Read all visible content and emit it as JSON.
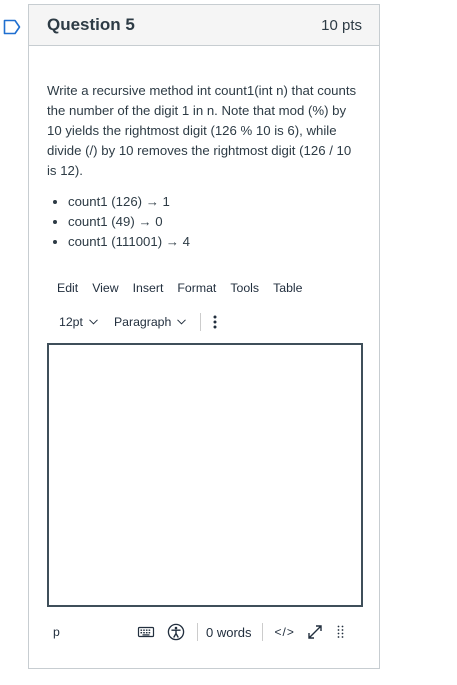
{
  "question": {
    "title": "Question 5",
    "points": "10 pts",
    "text": "Write a recursive method int count1(int n) that counts the number of the digit 1 in n. Note that mod (%) by 10 yields the rightmost digit (126 % 10 is 6), while divide (/) by 10 removes the rightmost digit (126 / 10 is 12).",
    "examples": [
      "count1 (126) → 1",
      "count1 (49) → 0",
      "count1 (111001) → 4"
    ]
  },
  "editor": {
    "menu": [
      "Edit",
      "View",
      "Insert",
      "Format",
      "Tools",
      "Table"
    ],
    "font_size": "12pt",
    "block_format": "Paragraph",
    "content": "",
    "status_path": "p",
    "word_count": "0 words",
    "code_toggle": "</>"
  },
  "colors": {
    "flag": "#1f6fd0",
    "header_bg": "#f5f5f5",
    "border": "#c7cdd1",
    "text": "#2d3b45",
    "editor_border": "#3f4f5a"
  },
  "icons": [
    "flag-icon",
    "chevron-down-icon",
    "more-vertical-icon",
    "keyboard-icon",
    "accessibility-icon",
    "html-editor-icon",
    "fullscreen-icon",
    "resize-grip-icon"
  ]
}
